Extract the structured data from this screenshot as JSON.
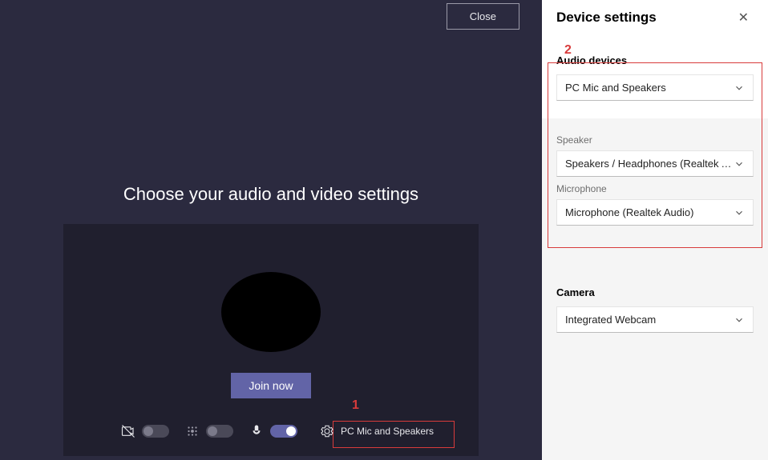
{
  "main": {
    "close_label": "Close",
    "heading": "Choose your audio and video settings",
    "join_label": "Join now",
    "device_pill_label": "PC Mic and Speakers"
  },
  "annotations": {
    "marker1": "1",
    "marker2": "2"
  },
  "side": {
    "title": "Device settings",
    "audio_label": "Audio devices",
    "audio_value": "PC Mic and Speakers",
    "speaker_label": "Speaker",
    "speaker_value": "Speakers / Headphones (Realtek Aud...",
    "mic_label": "Microphone",
    "mic_value": "Microphone (Realtek Audio)",
    "camera_label": "Camera",
    "camera_value": "Integrated Webcam"
  }
}
